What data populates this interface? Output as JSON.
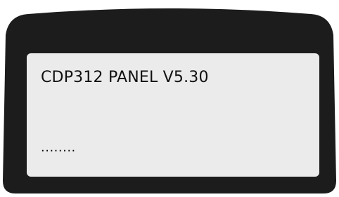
{
  "panel": {
    "title_line": "CDP312 PANEL V5.30",
    "status_line": "........"
  },
  "colors": {
    "bezel": "#1c1c1c",
    "screen": "#ebebeb",
    "text": "#111111",
    "background": "#ffffff"
  }
}
